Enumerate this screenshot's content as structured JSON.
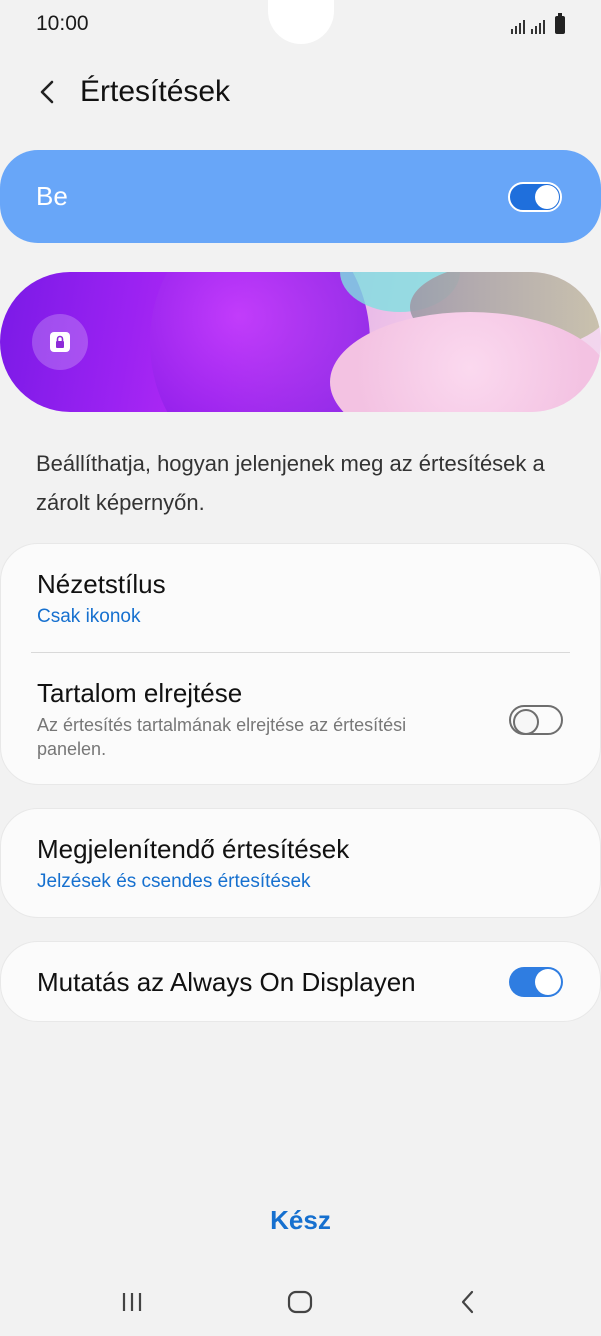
{
  "status_bar": {
    "time": "10:00"
  },
  "header": {
    "title": "Értesítések"
  },
  "master_switch": {
    "label": "Be",
    "state": "on"
  },
  "description": "Beállíthatja, hogyan jelenjenek meg az értesítések a zárolt képernyőn.",
  "settings": {
    "view_style": {
      "title": "Nézetstílus",
      "value": "Csak ikonok"
    },
    "hide_content": {
      "title": "Tartalom elrejtése",
      "summary": "Az értesítés tartalmának elrejtése az értesítési panelen.",
      "state": "off"
    },
    "notifications_to_show": {
      "title": "Megjelenítendő értesítések",
      "value": "Jelzések és csendes értesítések"
    },
    "show_on_aod": {
      "title": "Mutatás az Always On Displayen",
      "state": "on"
    }
  },
  "done_button": {
    "label": "Kész"
  },
  "colors": {
    "accent": "#1670cf",
    "master_bg": "#68a6f8",
    "toggle_on": "#2f7de1",
    "background": "#f2f2f2"
  },
  "nav_bar": {
    "icons": [
      "recents-icon",
      "home-icon",
      "back-icon"
    ]
  }
}
